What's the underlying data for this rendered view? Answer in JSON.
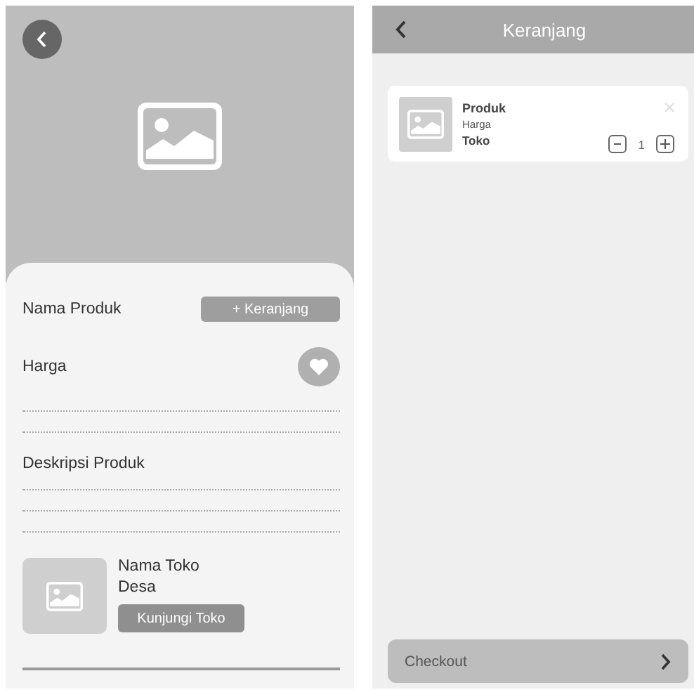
{
  "product_screen": {
    "product_name": "Nama Produk",
    "cart_button": "+ Keranjang",
    "price": "Harga",
    "description_title": "Deskripsi Produk",
    "store": {
      "name": "Nama Toko",
      "village": "Desa",
      "visit_button": "Kunjungi Toko"
    }
  },
  "cart_screen": {
    "title": "Keranjang",
    "items": [
      {
        "name": "Produk",
        "price": "Harga",
        "store": "Toko",
        "quantity": "1"
      }
    ],
    "checkout_button": "Checkout"
  }
}
